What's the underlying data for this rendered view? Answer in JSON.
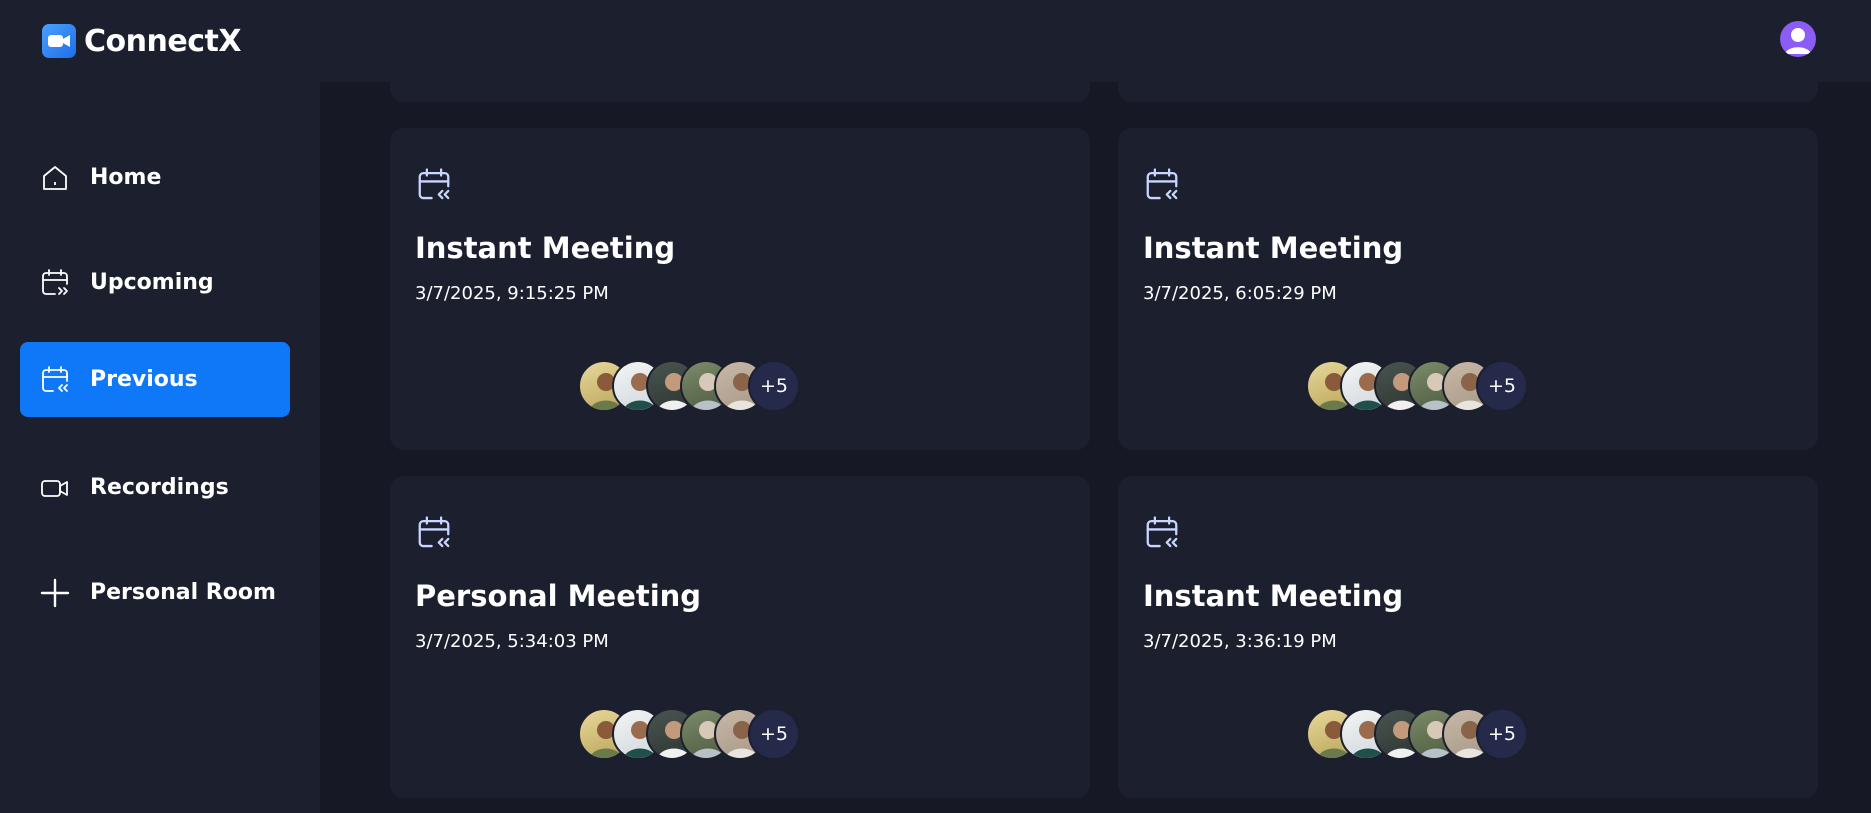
{
  "app": {
    "name": "ConnectX"
  },
  "sidebar": {
    "items": [
      {
        "label": "Home",
        "icon": "home-icon"
      },
      {
        "label": "Upcoming",
        "icon": "calendar-upcoming-icon"
      },
      {
        "label": "Previous",
        "icon": "calendar-previous-icon",
        "active": true
      },
      {
        "label": "Recordings",
        "icon": "video-icon"
      },
      {
        "label": "Personal Room",
        "icon": "plus-icon"
      }
    ]
  },
  "meetings": [
    {
      "title": "Instant Meeting",
      "date": "3/7/2025, 9:15:25 PM",
      "more": "+5"
    },
    {
      "title": "Instant Meeting",
      "date": "3/7/2025, 6:05:29 PM",
      "more": "+5"
    },
    {
      "title": "Personal Meeting",
      "date": "3/7/2025, 5:34:03 PM",
      "more": "+5"
    },
    {
      "title": "Instant Meeting",
      "date": "3/7/2025, 3:36:19 PM",
      "more": "+5"
    }
  ],
  "colors": {
    "background": "#161925",
    "panel": "#1c1f2e",
    "accent": "#0e78f9",
    "avatar": "#8b5cf6"
  }
}
